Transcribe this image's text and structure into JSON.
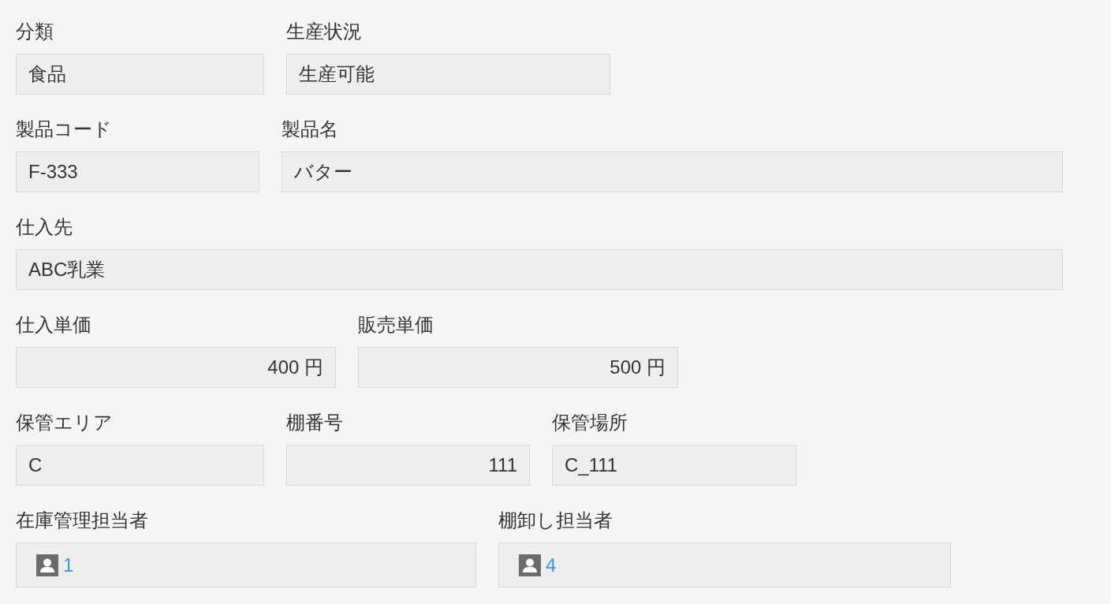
{
  "rows": [
    {
      "fields": [
        {
          "kind": "text",
          "label": "分類",
          "value": "食品"
        },
        {
          "kind": "text",
          "label": "生産状況",
          "value": "生産可能"
        }
      ]
    },
    {
      "fields": [
        {
          "kind": "text",
          "label": "製品コード",
          "value": "F-333"
        },
        {
          "kind": "text",
          "label": "製品名",
          "value": "バター"
        }
      ]
    },
    {
      "fields": [
        {
          "kind": "text",
          "label": "仕入先",
          "value": "ABC乳業"
        }
      ]
    },
    {
      "fields": [
        {
          "kind": "number",
          "label": "仕入単価",
          "value": "400 円"
        },
        {
          "kind": "number",
          "label": "販売単価",
          "value": "500 円"
        }
      ]
    },
    {
      "fields": [
        {
          "kind": "text",
          "label": "保管エリア",
          "value": "C"
        },
        {
          "kind": "number",
          "label": "棚番号",
          "value": "111"
        },
        {
          "kind": "text",
          "label": "保管場所",
          "value": "C_111"
        }
      ]
    },
    {
      "fields": [
        {
          "kind": "user",
          "label": "在庫管理担当者",
          "users": [
            {
              "name": "1"
            }
          ]
        },
        {
          "kind": "user",
          "label": "棚卸し担当者",
          "users": [
            {
              "name": "4"
            }
          ]
        }
      ]
    }
  ]
}
